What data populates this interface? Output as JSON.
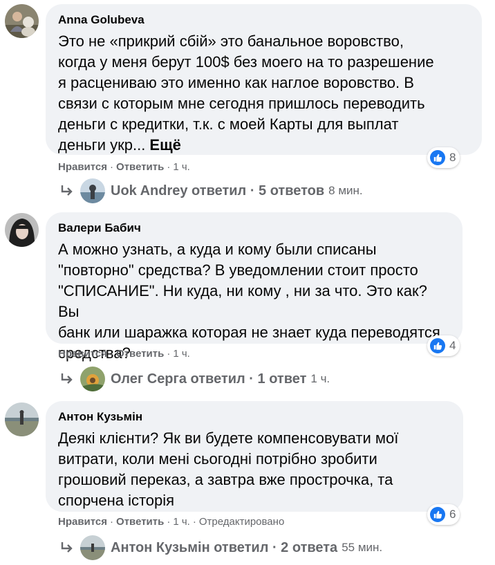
{
  "comments": [
    {
      "author": "Anna Golubeva",
      "text": "Это не «прикрий сбій» это банальное воровство,\nкогда у меня берут 100$ без моего на то разрешение\nя расцениваю это именно как наглое воровство. В\nсвязи с которым мне сегодня пришлось переводить\nденьги с кредитки, т.к. с моей Карты для выплат\nденьги укр... ",
      "more_label": "Ещё",
      "reaction_count": "8",
      "like_label": "Нравится",
      "reply_label": "Ответить",
      "time": "1 ч.",
      "edited": "",
      "replies": {
        "text": "Uok Andrey ответил · 5 ответов",
        "time": "8 мин."
      }
    },
    {
      "author": "Валери Бабич",
      "text": "А можно узнать, а куда и кому были списаны\n\"повторно\" средства? В уведомлении стоит просто\n\"СПИСАНИЕ\". Ни куда, ни кому , ни за что. Это как? Вы\nбанк или шаражка которая не знает куда переводятся\nсредства?",
      "reaction_count": "4",
      "like_label": "Нравится",
      "reply_label": "Ответить",
      "time": "1 ч.",
      "edited": "",
      "replies": {
        "text": "Олег Серга ответил · 1 ответ",
        "time": "1 ч."
      }
    },
    {
      "author": "Антон Кузьмін",
      "text": "Деякі клієнти? Як ви будете компенсовувати мої\nвитрати, коли мені сьогодні потрібно зробити\nгрошовий переказ, а завтра вже прострочка, та\nспорчена історія",
      "reaction_count": "6",
      "like_label": "Нравится",
      "reply_label": "Ответить",
      "time": "1 ч.",
      "edited": "Отредактировано",
      "replies": {
        "text": "Антон Кузьмін ответил · 2 ответа",
        "time": "55 мин."
      }
    }
  ],
  "icons": {
    "like": "like-thumb-icon",
    "reply_arrow": "reply-arrow-icon"
  },
  "colors": {
    "bubble": "#f0f2f5",
    "muted": "#65676b",
    "like_blue": "#1877f2"
  }
}
